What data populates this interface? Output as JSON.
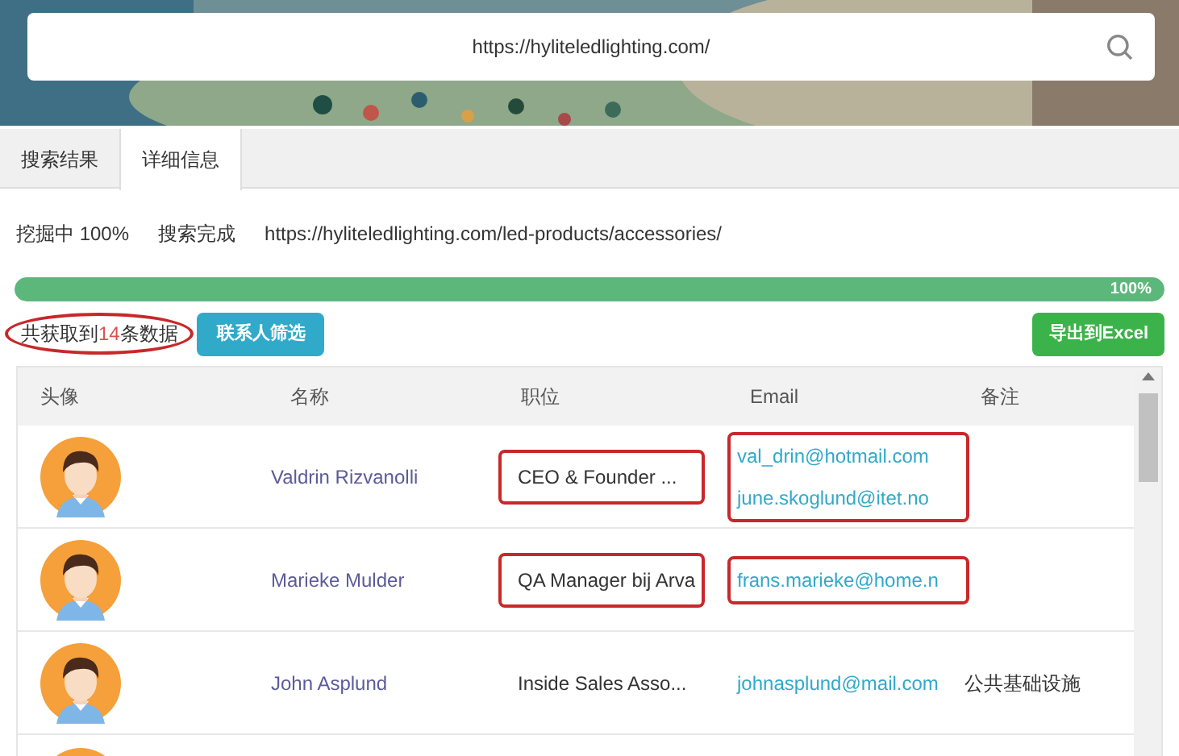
{
  "search": {
    "value": "https://hyliteledlighting.com/"
  },
  "tabs": [
    {
      "label": "搜索结果",
      "selected": false
    },
    {
      "label": "详细信息",
      "selected": true
    }
  ],
  "status": {
    "progress_text": "挖掘中 100%",
    "state_text": "搜索完成",
    "url": "https://hyliteledlighting.com/led-products/accessories/"
  },
  "progress": {
    "level": 1,
    "reading": "100%"
  },
  "summary": {
    "prefix": "共获取到",
    "count": "14",
    "suffix": "条数据",
    "highlighted": true
  },
  "filter_button": "联系人筛选",
  "export_button": "导出到Excel",
  "table": {
    "columns": [
      "头像",
      "名称",
      "职位",
      "Email",
      "备注"
    ],
    "rows": [
      {
        "kind": "full",
        "name": "Valdrin Rizvanolli",
        "position": "CEO & Founder ...",
        "position_highlighted": true,
        "emails": [
          "val_drin@hotmail.com",
          "june.skoglund@itet.no"
        ],
        "emails_highlighted": true
      },
      {
        "kind": "full",
        "name": "Marieke Mulder",
        "position": "QA Manager bij Arva",
        "position_highlighted": true,
        "emails": [
          "frans.marieke@home.n"
        ],
        "emails_highlighted": true
      },
      {
        "kind": "full",
        "name": "John Asplund",
        "position": "Inside Sales Asso...",
        "position_highlighted": false,
        "emails": [
          "johnasplund@mail.com"
        ],
        "emails_highlighted": false,
        "note": "公共基础设施"
      },
      {
        "kind": "cut"
      }
    ]
  }
}
